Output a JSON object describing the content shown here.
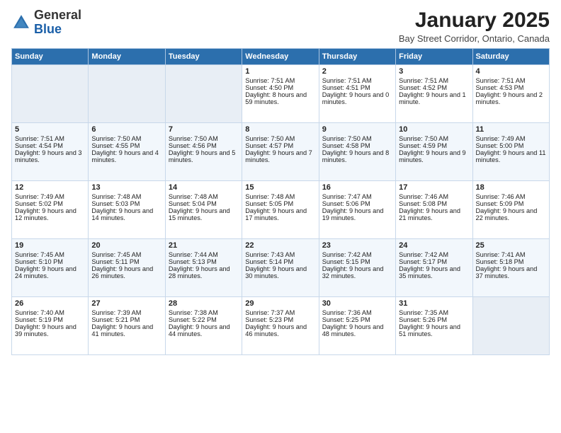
{
  "logo": {
    "general": "General",
    "blue": "Blue"
  },
  "header": {
    "month": "January 2025",
    "location": "Bay Street Corridor, Ontario, Canada"
  },
  "days_of_week": [
    "Sunday",
    "Monday",
    "Tuesday",
    "Wednesday",
    "Thursday",
    "Friday",
    "Saturday"
  ],
  "weeks": [
    [
      {
        "day": "",
        "content": ""
      },
      {
        "day": "",
        "content": ""
      },
      {
        "day": "",
        "content": ""
      },
      {
        "day": "1",
        "content": "Sunrise: 7:51 AM\nSunset: 4:50 PM\nDaylight: 8 hours and 59 minutes."
      },
      {
        "day": "2",
        "content": "Sunrise: 7:51 AM\nSunset: 4:51 PM\nDaylight: 9 hours and 0 minutes."
      },
      {
        "day": "3",
        "content": "Sunrise: 7:51 AM\nSunset: 4:52 PM\nDaylight: 9 hours and 1 minute."
      },
      {
        "day": "4",
        "content": "Sunrise: 7:51 AM\nSunset: 4:53 PM\nDaylight: 9 hours and 2 minutes."
      }
    ],
    [
      {
        "day": "5",
        "content": "Sunrise: 7:51 AM\nSunset: 4:54 PM\nDaylight: 9 hours and 3 minutes."
      },
      {
        "day": "6",
        "content": "Sunrise: 7:50 AM\nSunset: 4:55 PM\nDaylight: 9 hours and 4 minutes."
      },
      {
        "day": "7",
        "content": "Sunrise: 7:50 AM\nSunset: 4:56 PM\nDaylight: 9 hours and 5 minutes."
      },
      {
        "day": "8",
        "content": "Sunrise: 7:50 AM\nSunset: 4:57 PM\nDaylight: 9 hours and 7 minutes."
      },
      {
        "day": "9",
        "content": "Sunrise: 7:50 AM\nSunset: 4:58 PM\nDaylight: 9 hours and 8 minutes."
      },
      {
        "day": "10",
        "content": "Sunrise: 7:50 AM\nSunset: 4:59 PM\nDaylight: 9 hours and 9 minutes."
      },
      {
        "day": "11",
        "content": "Sunrise: 7:49 AM\nSunset: 5:00 PM\nDaylight: 9 hours and 11 minutes."
      }
    ],
    [
      {
        "day": "12",
        "content": "Sunrise: 7:49 AM\nSunset: 5:02 PM\nDaylight: 9 hours and 12 minutes."
      },
      {
        "day": "13",
        "content": "Sunrise: 7:48 AM\nSunset: 5:03 PM\nDaylight: 9 hours and 14 minutes."
      },
      {
        "day": "14",
        "content": "Sunrise: 7:48 AM\nSunset: 5:04 PM\nDaylight: 9 hours and 15 minutes."
      },
      {
        "day": "15",
        "content": "Sunrise: 7:48 AM\nSunset: 5:05 PM\nDaylight: 9 hours and 17 minutes."
      },
      {
        "day": "16",
        "content": "Sunrise: 7:47 AM\nSunset: 5:06 PM\nDaylight: 9 hours and 19 minutes."
      },
      {
        "day": "17",
        "content": "Sunrise: 7:46 AM\nSunset: 5:08 PM\nDaylight: 9 hours and 21 minutes."
      },
      {
        "day": "18",
        "content": "Sunrise: 7:46 AM\nSunset: 5:09 PM\nDaylight: 9 hours and 22 minutes."
      }
    ],
    [
      {
        "day": "19",
        "content": "Sunrise: 7:45 AM\nSunset: 5:10 PM\nDaylight: 9 hours and 24 minutes."
      },
      {
        "day": "20",
        "content": "Sunrise: 7:45 AM\nSunset: 5:11 PM\nDaylight: 9 hours and 26 minutes."
      },
      {
        "day": "21",
        "content": "Sunrise: 7:44 AM\nSunset: 5:13 PM\nDaylight: 9 hours and 28 minutes."
      },
      {
        "day": "22",
        "content": "Sunrise: 7:43 AM\nSunset: 5:14 PM\nDaylight: 9 hours and 30 minutes."
      },
      {
        "day": "23",
        "content": "Sunrise: 7:42 AM\nSunset: 5:15 PM\nDaylight: 9 hours and 32 minutes."
      },
      {
        "day": "24",
        "content": "Sunrise: 7:42 AM\nSunset: 5:17 PM\nDaylight: 9 hours and 35 minutes."
      },
      {
        "day": "25",
        "content": "Sunrise: 7:41 AM\nSunset: 5:18 PM\nDaylight: 9 hours and 37 minutes."
      }
    ],
    [
      {
        "day": "26",
        "content": "Sunrise: 7:40 AM\nSunset: 5:19 PM\nDaylight: 9 hours and 39 minutes."
      },
      {
        "day": "27",
        "content": "Sunrise: 7:39 AM\nSunset: 5:21 PM\nDaylight: 9 hours and 41 minutes."
      },
      {
        "day": "28",
        "content": "Sunrise: 7:38 AM\nSunset: 5:22 PM\nDaylight: 9 hours and 44 minutes."
      },
      {
        "day": "29",
        "content": "Sunrise: 7:37 AM\nSunset: 5:23 PM\nDaylight: 9 hours and 46 minutes."
      },
      {
        "day": "30",
        "content": "Sunrise: 7:36 AM\nSunset: 5:25 PM\nDaylight: 9 hours and 48 minutes."
      },
      {
        "day": "31",
        "content": "Sunrise: 7:35 AM\nSunset: 5:26 PM\nDaylight: 9 hours and 51 minutes."
      },
      {
        "day": "",
        "content": ""
      }
    ]
  ]
}
